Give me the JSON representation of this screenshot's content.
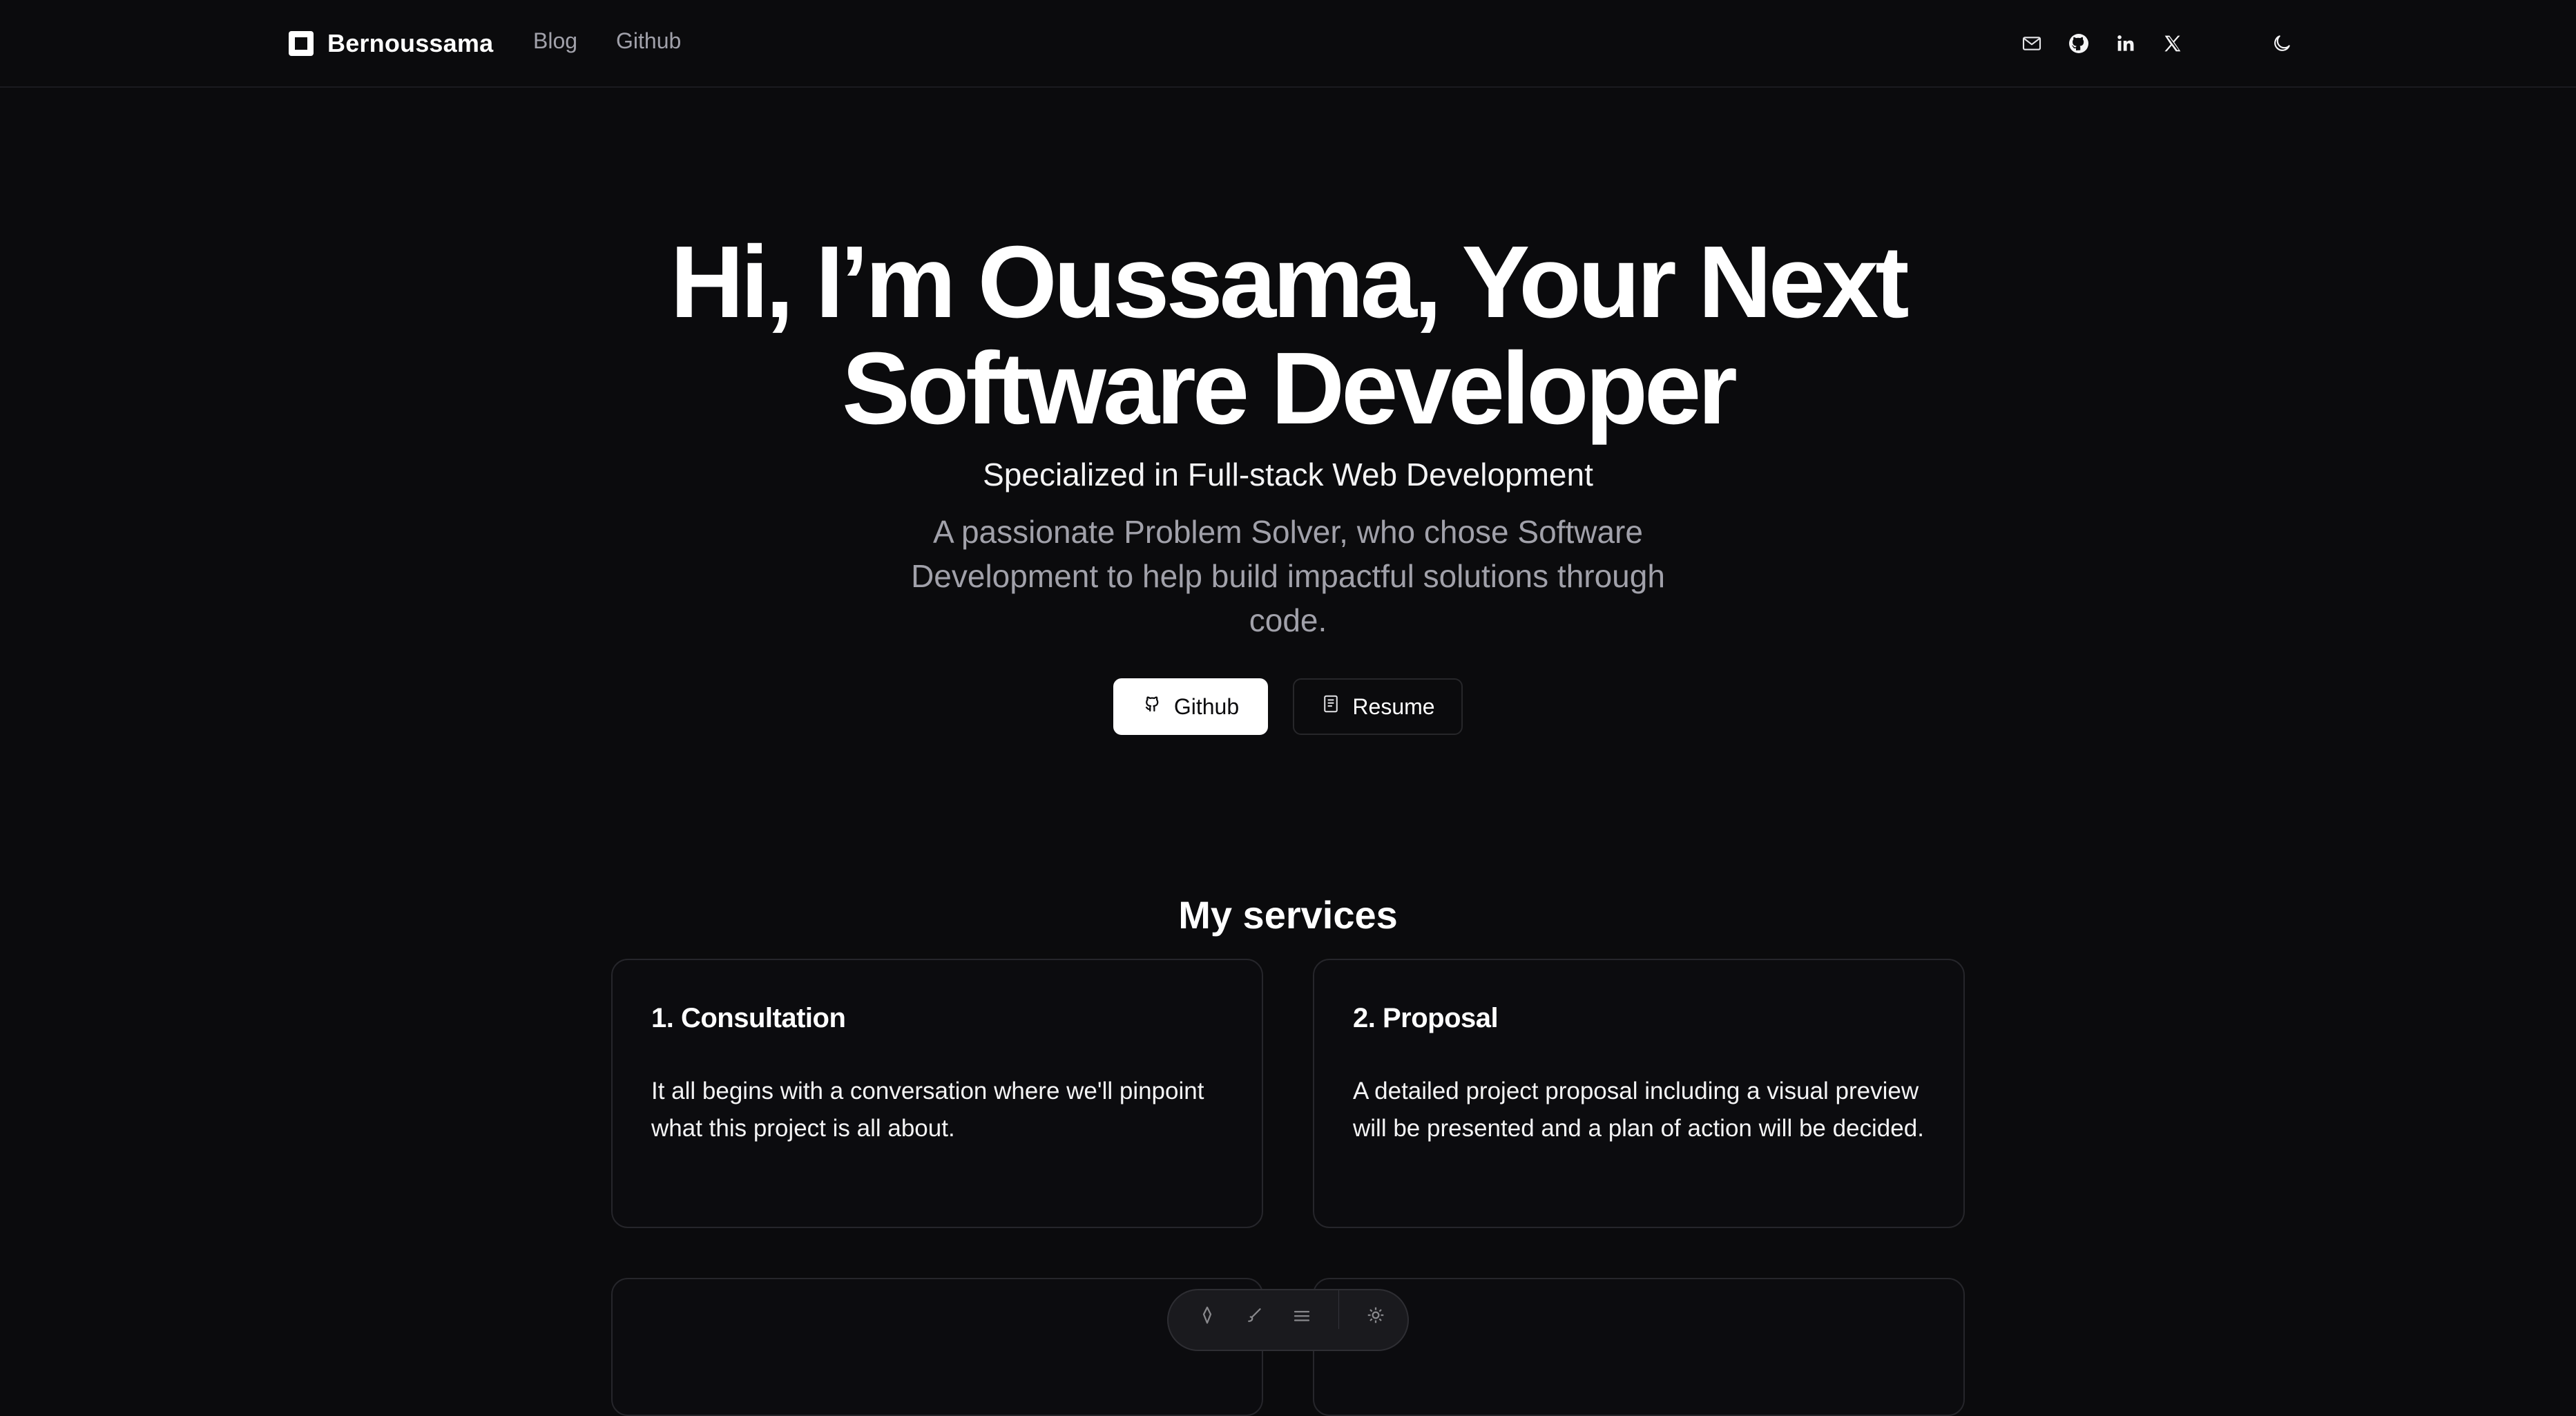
{
  "nav": {
    "brand": "Bernoussama",
    "links": [
      {
        "label": "Blog"
      },
      {
        "label": "Github"
      }
    ],
    "icons": [
      "mail-icon",
      "github-icon",
      "linkedin-icon",
      "x-icon",
      "moon-icon"
    ]
  },
  "hero": {
    "title_line1": "Hi, I’m Oussama, Your Next",
    "title_line2": "Software Developer",
    "subtitle": "Specialized in Full-stack Web Development",
    "description_line1": "A passionate Problem Solver, who chose Software",
    "description_line2": "Development to help build impactful solutions through",
    "description_line3": "code.",
    "buttons": [
      {
        "label": "Github",
        "icon": "github-icon"
      },
      {
        "label": "Resume",
        "icon": "document-icon"
      }
    ]
  },
  "services": {
    "title": "My services",
    "cards": [
      {
        "title": "1. Consultation",
        "body": "It all begins with a conversation where we'll pinpoint what this project is all about."
      },
      {
        "title": "2. Proposal",
        "body": "A detailed project proposal including a visual preview will be presented and a plan of action will be decided."
      }
    ]
  },
  "toolbar": {
    "icons": [
      "pen-icon",
      "brush-icon",
      "layers-icon",
      "settings-icon"
    ]
  },
  "colors": {
    "background": "#0b0b0d",
    "text": "#ffffff",
    "muted": "#a1a1aa",
    "border": "#26262b"
  }
}
